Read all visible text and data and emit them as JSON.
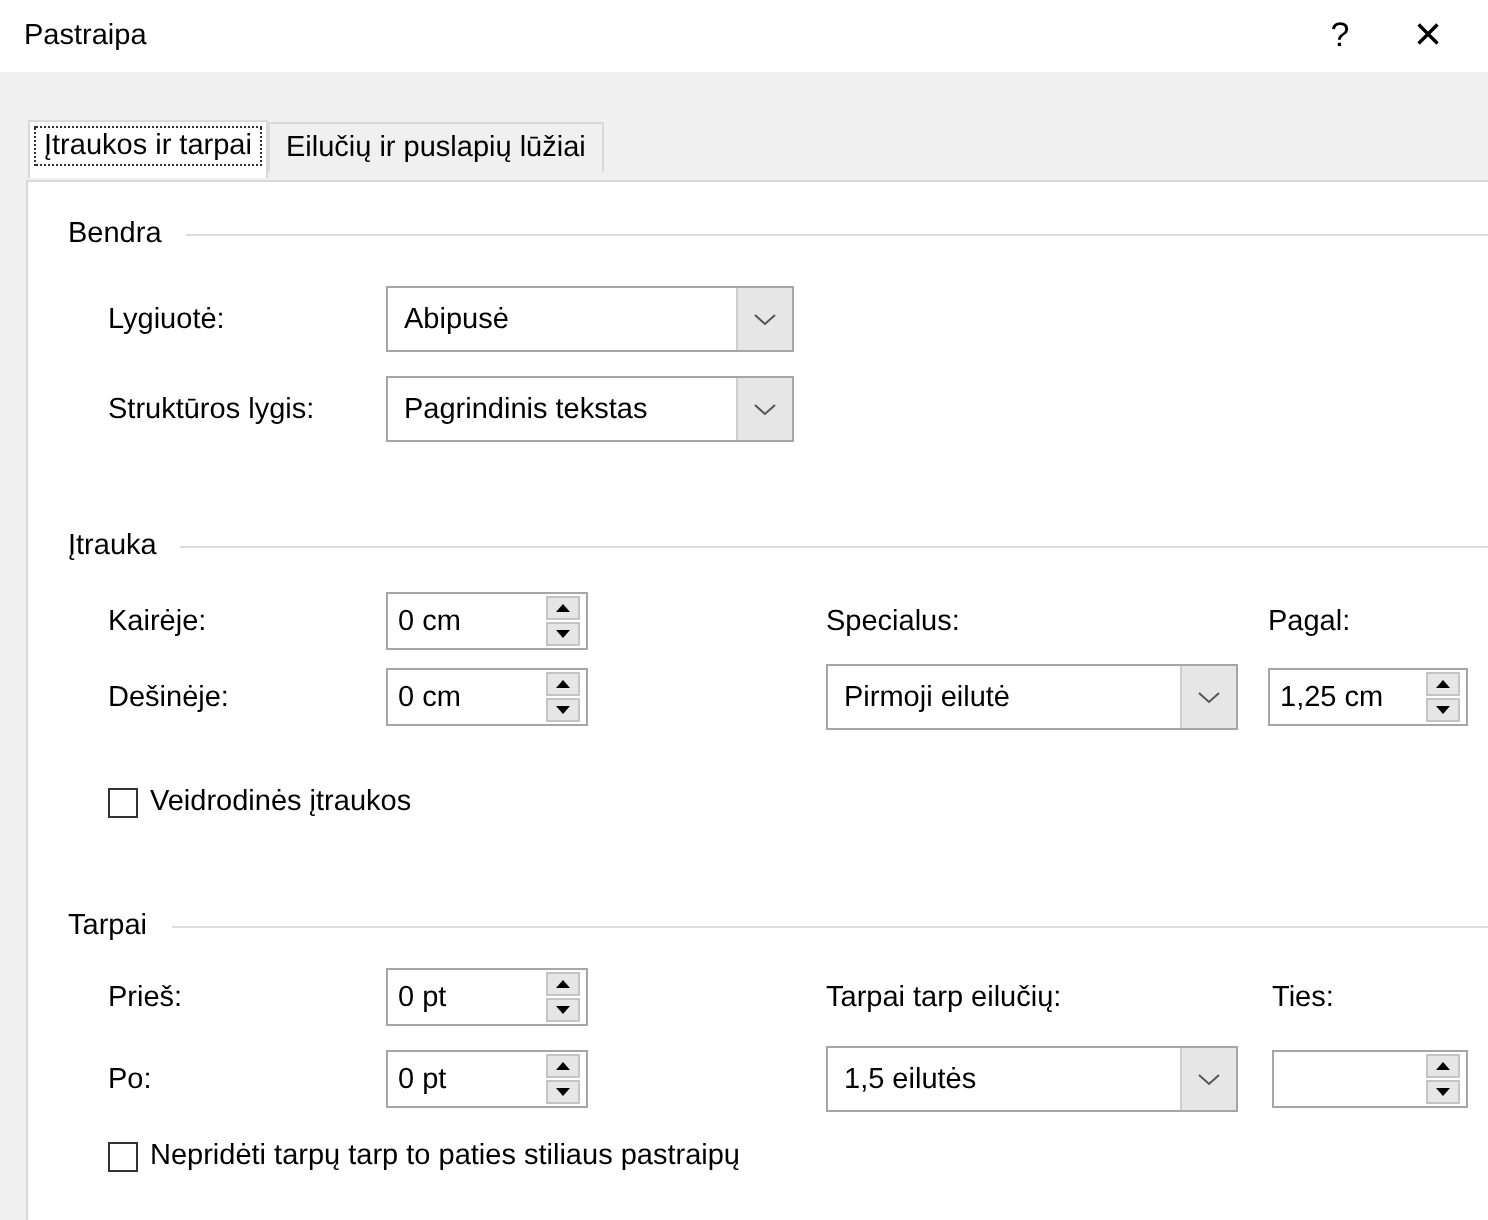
{
  "window": {
    "title": "Pastraipa",
    "help": "?",
    "close": "×"
  },
  "tabs": [
    {
      "label": "Įtraukos ir tarpai",
      "selected": true
    },
    {
      "label": "Eilučių ir puslapių lūžiai",
      "selected": false
    }
  ],
  "general": {
    "title": "Bendra",
    "fields": [
      {
        "label": "Lygiuotė:",
        "value": "Abipusė"
      },
      {
        "label": "Struktūros lygis:",
        "value": "Pagrindinis tekstas"
      }
    ]
  },
  "indentation": {
    "title": "Įtrauka",
    "left": {
      "label": "Kairėje:",
      "value": "0 cm"
    },
    "right": {
      "label": "Dešinėje:",
      "value": "0 cm"
    },
    "special": {
      "label": "Specialus:",
      "value": "Pirmoji eilutė"
    },
    "by": {
      "label": "Pagal:",
      "value": "1,25 cm"
    },
    "mirror": {
      "label": "Veidrodinės įtraukos",
      "checked": false
    }
  },
  "spacing": {
    "title": "Tarpai",
    "before": {
      "label": "Prieš:",
      "value": "0 pt"
    },
    "after": {
      "label": "Po:",
      "value": "0 pt"
    },
    "line_spacing": {
      "label": "Tarpai tarp eilučių:",
      "value": "1,5 eilutės"
    },
    "at": {
      "label": "Ties:"
    },
    "no_space": {
      "label": "Nepridėti tarpų tarp to paties stiliaus pastraipų",
      "checked": false
    }
  }
}
